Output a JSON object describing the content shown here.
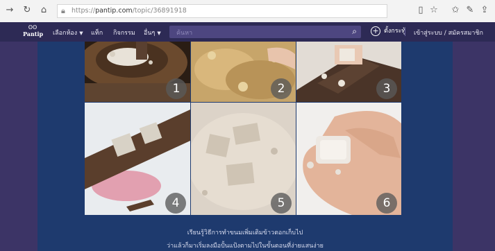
{
  "browser": {
    "url_scheme": "https://",
    "url_host": "pantip.com",
    "url_path": "/topic/36891918"
  },
  "nav": {
    "logo_text": "Pantip",
    "menu_rooms": "เลือกห้อง",
    "menu_tag": "แท็ก",
    "menu_activity": "กิจกรรม",
    "menu_more": "อื่นๆ",
    "search_placeholder": "ค้นหา",
    "new_topic": "ตั้งกระทู้",
    "login": "เข้าสู่ระบบ / สมัครสมาชิก"
  },
  "photos": [
    {
      "label": "1"
    },
    {
      "label": "2"
    },
    {
      "label": "3"
    },
    {
      "label": "4"
    },
    {
      "label": "5"
    },
    {
      "label": "6"
    }
  ],
  "captions": {
    "line1": "เรียนรู้วิธีการทำขนมเพิ่มเติมข้าวตอกเก็บไป",
    "line2": "ว่าแล้วก็มาเริ่มลงมือปั้นแป้งตามไปในขั้นตอนที่ง่ายแสนง่าย"
  },
  "colors": {
    "page_bg": "#3c3466",
    "nav_bg": "#2d2a55",
    "content_bg": "#1e3a6e"
  }
}
